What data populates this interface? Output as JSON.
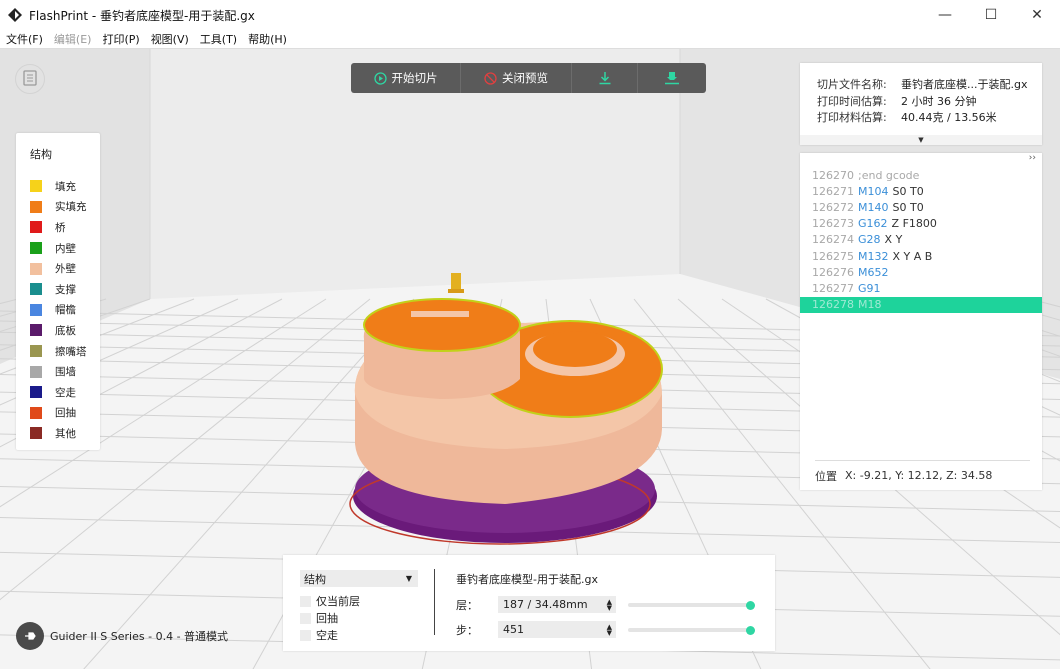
{
  "window": {
    "title": "FlashPrint - 垂钓者底座模型-用于装配.gx",
    "minimize": "—",
    "maximize": "☐",
    "close": "✕"
  },
  "menu": [
    "文件(F)",
    "编辑(E)",
    "打印(P)",
    "视图(V)",
    "工具(T)",
    "帮助(H)"
  ],
  "toolbar": {
    "start_slice": "开始切片",
    "close_preview": "关闭预览"
  },
  "legend": {
    "title": "结构",
    "items": [
      {
        "label": "填充",
        "color": "#f6d21a"
      },
      {
        "label": "实填充",
        "color": "#f07d18"
      },
      {
        "label": "桥",
        "color": "#e01a1a"
      },
      {
        "label": "内壁",
        "color": "#1aa01a"
      },
      {
        "label": "外壁",
        "color": "#f2c09e"
      },
      {
        "label": "支撑",
        "color": "#1a8e8e"
      },
      {
        "label": "帽檐",
        "color": "#4a86e0"
      },
      {
        "label": "底板",
        "color": "#5a1a6a"
      },
      {
        "label": "擦嘴塔",
        "color": "#9a9650"
      },
      {
        "label": "围墙",
        "color": "#a8a8a8"
      },
      {
        "label": "空走",
        "color": "#1a1a8a"
      },
      {
        "label": "回抽",
        "color": "#e04a1a"
      },
      {
        "label": "其他",
        "color": "#8a2a24"
      }
    ]
  },
  "info": {
    "rows": [
      {
        "key": "切片文件名称:",
        "value": "垂钓者底座模...于装配.gx"
      },
      {
        "key": "打印时间估算:",
        "value": "2 小时 36 分钟"
      },
      {
        "key": "打印材料估算:",
        "value": "40.44克 / 13.56米"
      }
    ]
  },
  "gcode": {
    "expand": "››",
    "lines": [
      {
        "num": "126270",
        "cmd": "",
        "args": "",
        "comment": ";end gcode"
      },
      {
        "num": "126271",
        "cmd": "M104",
        "args": "S0 T0",
        "comment": ""
      },
      {
        "num": "126272",
        "cmd": "M140",
        "args": "S0 T0",
        "comment": ""
      },
      {
        "num": "126273",
        "cmd": "G162",
        "args": "Z F1800",
        "comment": ""
      },
      {
        "num": "126274",
        "cmd": "G28",
        "args": "X Y",
        "comment": ""
      },
      {
        "num": "126275",
        "cmd": "M132",
        "args": "X Y A B",
        "comment": ""
      },
      {
        "num": "126276",
        "cmd": "M652",
        "args": "",
        "comment": ""
      },
      {
        "num": "126277",
        "cmd": "G91",
        "args": "",
        "comment": ""
      },
      {
        "num": "126278",
        "cmd": "M18",
        "args": "",
        "comment": ""
      }
    ],
    "active_index": 8,
    "position_label": "位置",
    "position_value": "X: -9.21, Y: 12.12, Z: 34.58"
  },
  "printer": {
    "label": "Guider II S Series - 0.4 - 普通模式"
  },
  "bottom": {
    "view_select": "结构",
    "checks": [
      "仅当前层",
      "回抽",
      "空走"
    ],
    "file_name": "垂钓者底座模型-用于装配.gx",
    "layer_label": "层：",
    "layer_value": "187 / 34.48mm",
    "step_label": "步：",
    "step_value": "451",
    "layer_slider": 1.0,
    "step_slider": 1.0
  },
  "colors": {
    "accent": "#1ed39b",
    "toolbar_bg": "#5a5a5a"
  }
}
